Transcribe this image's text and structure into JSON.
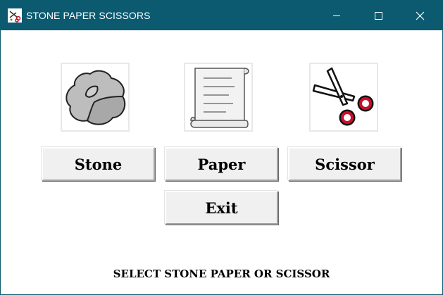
{
  "window": {
    "title": "STONE PAPER SCISSORS",
    "titlebar_color": "#0b5a70"
  },
  "choices": {
    "stone_image": "stone-icon",
    "paper_image": "paper-scroll-icon",
    "scissor_image": "scissors-icon"
  },
  "buttons": {
    "stone": "Stone",
    "paper": "Paper",
    "scissor": "Scissor",
    "exit": "Exit"
  },
  "status": {
    "message": "SELECT STONE PAPER OR SCISSOR"
  }
}
